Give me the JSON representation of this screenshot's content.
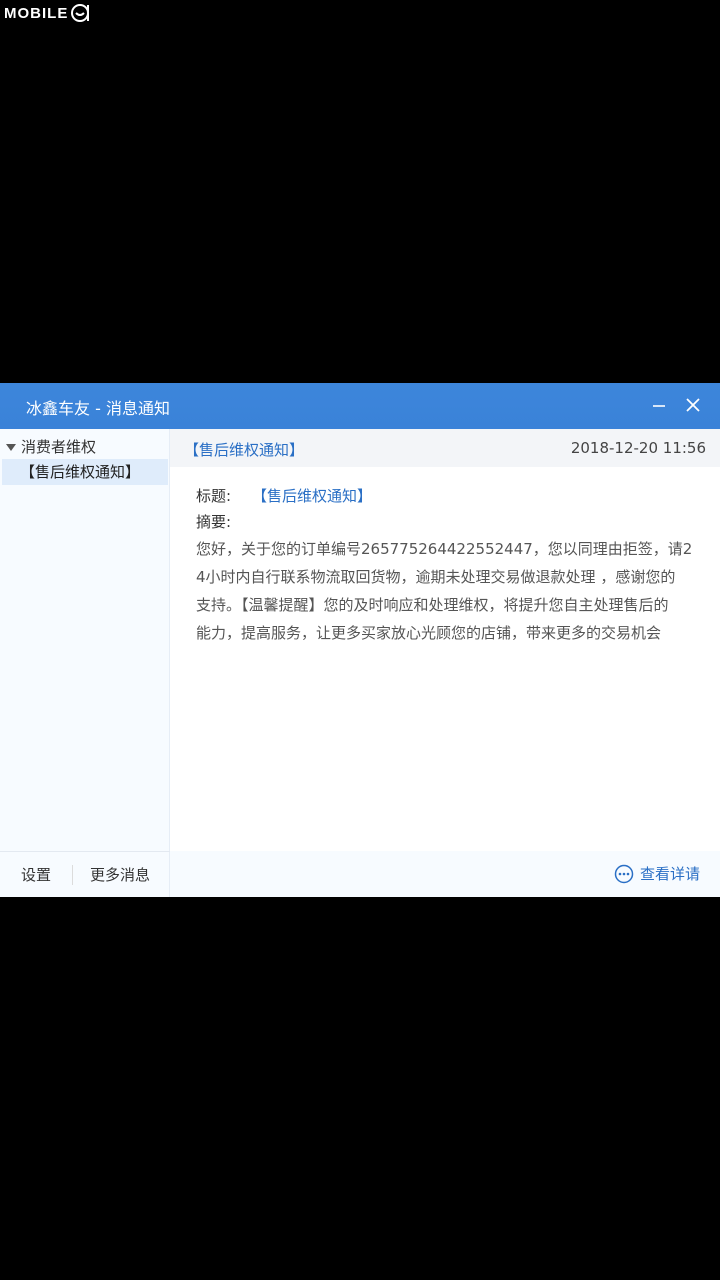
{
  "watermark": {
    "text": "MOBILE"
  },
  "window": {
    "title": "冰鑫车友 - 消息通知",
    "minimize_icon": "minimize-icon",
    "close_icon": "close-icon"
  },
  "sidebar": {
    "group_label": "消费者维权",
    "items": [
      {
        "label": "【售后维权通知】",
        "selected": true
      }
    ],
    "footer": {
      "settings_label": "设置",
      "more_label": "更多消息"
    }
  },
  "message": {
    "header_title": "【售后维权通知】",
    "timestamp": "2018-12-20 11:56",
    "title_label": "标题:",
    "title_value": "【售后维权通知】",
    "summary_label": "摘要:",
    "body_lines": [
      "您好，关于您的订单编号265775264422552447，您以同理由拒签，请2",
      "4小时内自行联系物流取回货物，逾期未处理交易做退款处理 ，感谢您的",
      "支持。【温馨提醒】您的及时响应和处理维权，将提升您自主处理售后的",
      "能力，提高服务，让更多买家放心光顾您的店铺，带来更多的交易机会"
    ]
  },
  "footer": {
    "detail_label": "查看详请"
  },
  "colors": {
    "titlebar": "#3a82d8",
    "link": "#2a6fc5",
    "selected": "#dfecfb"
  }
}
